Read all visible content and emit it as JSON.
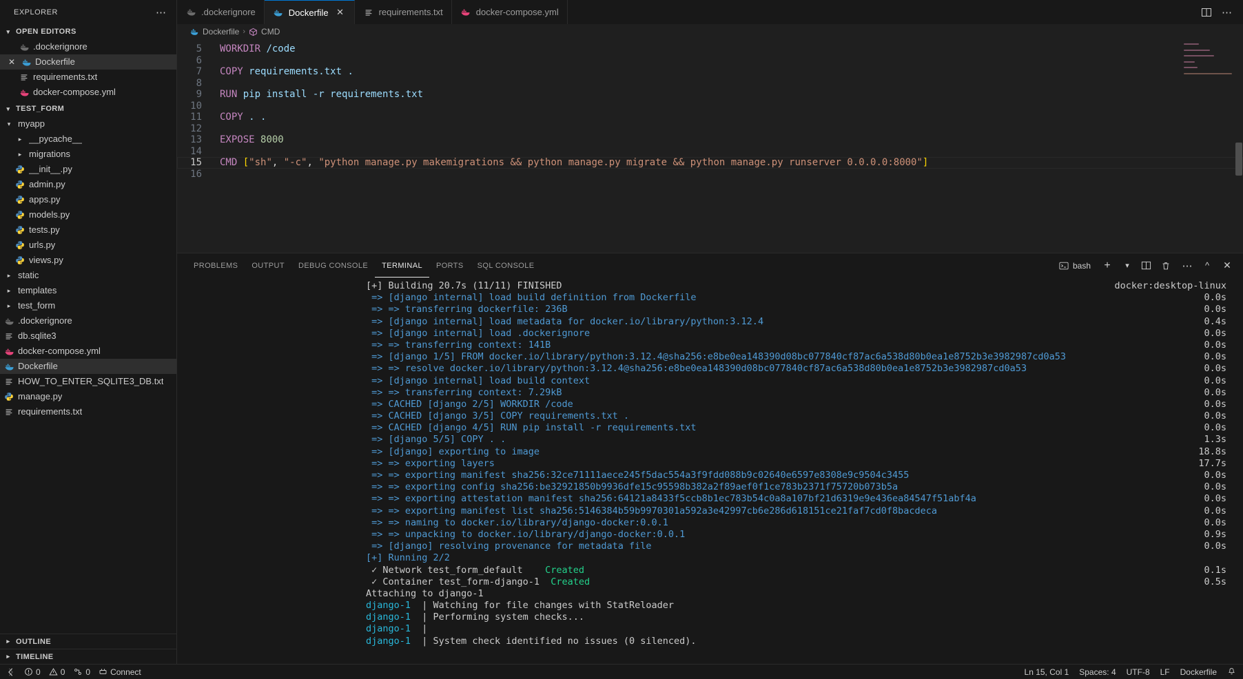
{
  "sidebar": {
    "title": "EXPLORER",
    "more_icon": "ellipsis-icon",
    "open_editors": {
      "label": "OPEN EDITORS",
      "items": [
        {
          "label": ".dockerignore",
          "icon": "docker-icon-dim",
          "active": false,
          "closable": false,
          "indent": 38
        },
        {
          "label": "Dockerfile",
          "icon": "docker-icon",
          "active": true,
          "closable": true,
          "indent": 20
        },
        {
          "label": "requirements.txt",
          "icon": "text-icon",
          "active": false,
          "closable": false,
          "indent": 38
        },
        {
          "label": "docker-compose.yml",
          "icon": "compose-icon",
          "active": false,
          "closable": false,
          "indent": 38
        }
      ]
    },
    "project": {
      "label": "TEST_FORM",
      "items": [
        {
          "label": "myapp",
          "type": "folder-open",
          "indent": 16
        },
        {
          "label": "__pycache__",
          "type": "folder",
          "indent": 32
        },
        {
          "label": "migrations",
          "type": "folder",
          "indent": 32
        },
        {
          "label": "__init__.py",
          "type": "python",
          "indent": 32
        },
        {
          "label": "admin.py",
          "type": "python",
          "indent": 32
        },
        {
          "label": "apps.py",
          "type": "python",
          "indent": 32
        },
        {
          "label": "models.py",
          "type": "python",
          "indent": 32
        },
        {
          "label": "tests.py",
          "type": "python",
          "indent": 32
        },
        {
          "label": "urls.py",
          "type": "python",
          "indent": 32
        },
        {
          "label": "views.py",
          "type": "python",
          "indent": 32
        },
        {
          "label": "static",
          "type": "folder",
          "indent": 16
        },
        {
          "label": "templates",
          "type": "folder",
          "indent": 16
        },
        {
          "label": "test_form",
          "type": "folder",
          "indent": 16
        },
        {
          "label": ".dockerignore",
          "type": "docker-dim",
          "indent": 16
        },
        {
          "label": "db.sqlite3",
          "type": "text",
          "indent": 16
        },
        {
          "label": "docker-compose.yml",
          "type": "compose",
          "indent": 16
        },
        {
          "label": "Dockerfile",
          "type": "docker",
          "indent": 16,
          "active": true
        },
        {
          "label": "HOW_TO_ENTER_SQLITE3_DB.txt",
          "type": "text",
          "indent": 16
        },
        {
          "label": "manage.py",
          "type": "python",
          "indent": 16
        },
        {
          "label": "requirements.txt",
          "type": "text",
          "indent": 16
        }
      ]
    },
    "footer": [
      {
        "label": "OUTLINE"
      },
      {
        "label": "TIMELINE"
      }
    ]
  },
  "tabs": {
    "items": [
      {
        "label": ".dockerignore",
        "icon": "docker-icon-dim",
        "active": false,
        "closable": false
      },
      {
        "label": "Dockerfile",
        "icon": "docker-icon",
        "active": true,
        "closable": true
      },
      {
        "label": "requirements.txt",
        "icon": "text-icon",
        "active": false,
        "closable": false
      },
      {
        "label": "docker-compose.yml",
        "icon": "compose-icon",
        "active": false,
        "closable": false
      }
    ],
    "actions": [
      {
        "name": "split-editor-icon"
      },
      {
        "name": "more-actions-icon"
      }
    ]
  },
  "breadcrumb": {
    "file": "Dockerfile",
    "separator": "›",
    "symbol": "CMD",
    "symbol_icon": "cube-icon"
  },
  "editor": {
    "lines": [
      {
        "n": "5",
        "tokens": [
          {
            "t": "WORKDIR",
            "c": "kw"
          },
          {
            "t": " ",
            "c": "plain"
          },
          {
            "t": "/code",
            "c": "path"
          }
        ]
      },
      {
        "n": "6",
        "tokens": []
      },
      {
        "n": "7",
        "tokens": [
          {
            "t": "COPY",
            "c": "kw"
          },
          {
            "t": " ",
            "c": "plain"
          },
          {
            "t": "requirements.txt .",
            "c": "path"
          }
        ]
      },
      {
        "n": "8",
        "tokens": []
      },
      {
        "n": "9",
        "tokens": [
          {
            "t": "RUN",
            "c": "kw"
          },
          {
            "t": " pip install -r requirements.txt",
            "c": "path"
          }
        ]
      },
      {
        "n": "10",
        "tokens": []
      },
      {
        "n": "11",
        "tokens": [
          {
            "t": "COPY",
            "c": "kw"
          },
          {
            "t": " ",
            "c": "plain"
          },
          {
            "t": ". .",
            "c": "path"
          }
        ]
      },
      {
        "n": "12",
        "tokens": []
      },
      {
        "n": "13",
        "tokens": [
          {
            "t": "EXPOSE",
            "c": "kw"
          },
          {
            "t": " ",
            "c": "plain"
          },
          {
            "t": "8000",
            "c": "num"
          }
        ]
      },
      {
        "n": "14",
        "tokens": []
      },
      {
        "n": "15",
        "current": true,
        "tokens": [
          {
            "t": "CMD",
            "c": "kw"
          },
          {
            "t": " ",
            "c": "plain"
          },
          {
            "t": "[",
            "c": "brk"
          },
          {
            "t": "\"sh\"",
            "c": "str"
          },
          {
            "t": ", ",
            "c": "plain"
          },
          {
            "t": "\"-c\"",
            "c": "str"
          },
          {
            "t": ", ",
            "c": "plain"
          },
          {
            "t": "\"python manage.py makemigrations && python manage.py migrate && python manage.py runserver 0.0.0.0:8000\"",
            "c": "str"
          },
          {
            "t": "]",
            "c": "brk"
          }
        ]
      },
      {
        "n": "16",
        "tokens": []
      }
    ]
  },
  "panel": {
    "tabs": [
      {
        "label": "PROBLEMS",
        "active": false
      },
      {
        "label": "OUTPUT",
        "active": false
      },
      {
        "label": "DEBUG CONSOLE",
        "active": false
      },
      {
        "label": "TERMINAL",
        "active": true
      },
      {
        "label": "PORTS",
        "active": false
      },
      {
        "label": "SQL CONSOLE",
        "active": false
      }
    ],
    "shell": {
      "label": "bash",
      "icon": "terminal-bash-icon"
    },
    "actions": [
      {
        "name": "new-terminal-icon",
        "glyph": "+"
      },
      {
        "name": "chevron-down-icon",
        "glyph": "⌄"
      },
      {
        "name": "split-terminal-icon",
        "glyph": "◫"
      },
      {
        "name": "kill-terminal-icon",
        "glyph": "🗑"
      },
      {
        "name": "more-actions-icon",
        "glyph": "⋯"
      },
      {
        "name": "maximize-panel-icon",
        "glyph": "⌃"
      },
      {
        "name": "close-panel-icon",
        "glyph": "✕"
      }
    ],
    "context_label": "docker:desktop-linux"
  },
  "terminal": {
    "lines": [
      {
        "msg": "[+] Building 20.7s (11/11) FINISHED",
        "color": "c-white",
        "dur": ""
      },
      {
        "msg": " => [django internal] load build definition from Dockerfile",
        "color": "c-blue",
        "dur": "0.0s"
      },
      {
        "msg": " => => transferring dockerfile: 236B",
        "color": "c-blue",
        "dur": "0.0s"
      },
      {
        "msg": " => [django internal] load metadata for docker.io/library/python:3.12.4",
        "color": "c-blue",
        "dur": "0.4s"
      },
      {
        "msg": " => [django internal] load .dockerignore",
        "color": "c-blue",
        "dur": "0.0s"
      },
      {
        "msg": " => => transferring context: 141B",
        "color": "c-blue",
        "dur": "0.0s"
      },
      {
        "msg": " => [django 1/5] FROM docker.io/library/python:3.12.4@sha256:e8be0ea148390d08bc077840cf87ac6a538d80b0ea1e8752b3e3982987cd0a53",
        "color": "c-blue",
        "dur": "0.0s"
      },
      {
        "msg": " => => resolve docker.io/library/python:3.12.4@sha256:e8be0ea148390d08bc077840cf87ac6a538d80b0ea1e8752b3e3982987cd0a53",
        "color": "c-blue",
        "dur": "0.0s"
      },
      {
        "msg": " => [django internal] load build context",
        "color": "c-blue",
        "dur": "0.0s"
      },
      {
        "msg": " => => transferring context: 7.29kB",
        "color": "c-blue",
        "dur": "0.0s"
      },
      {
        "msg": " => CACHED [django 2/5] WORKDIR /code",
        "color": "c-blue",
        "dur": "0.0s"
      },
      {
        "msg": " => CACHED [django 3/5] COPY requirements.txt .",
        "color": "c-blue",
        "dur": "0.0s"
      },
      {
        "msg": " => CACHED [django 4/5] RUN pip install -r requirements.txt",
        "color": "c-blue",
        "dur": "0.0s"
      },
      {
        "msg": " => [django 5/5] COPY . .",
        "color": "c-blue",
        "dur": "1.3s"
      },
      {
        "msg": " => [django] exporting to image",
        "color": "c-blue",
        "dur": "18.8s"
      },
      {
        "msg": " => => exporting layers",
        "color": "c-blue",
        "dur": "17.7s"
      },
      {
        "msg": " => => exporting manifest sha256:32ce71111aece245f5dac554a3f9fdd088b9c02640e6597e8308e9c9504c3455",
        "color": "c-blue",
        "dur": "0.0s"
      },
      {
        "msg": " => => exporting config sha256:be32921850b9936dfe15c95598b382a2f89aef0f1ce783b2371f75720b073b5a",
        "color": "c-blue",
        "dur": "0.0s"
      },
      {
        "msg": " => => exporting attestation manifest sha256:64121a8433f5ccb8b1ec783b54c0a8a107bf21d6319e9e436ea84547f51abf4a",
        "color": "c-blue",
        "dur": "0.0s"
      },
      {
        "msg": " => => exporting manifest list sha256:5146384b59b9970301a592a3e42997cb6e286d618151ce21faf7cd0f8bacdeca",
        "color": "c-blue",
        "dur": "0.0s"
      },
      {
        "msg": " => => naming to docker.io/library/django-docker:0.0.1",
        "color": "c-blue",
        "dur": "0.0s"
      },
      {
        "msg": " => => unpacking to docker.io/library/django-docker:0.0.1",
        "color": "c-blue",
        "dur": "0.9s"
      },
      {
        "msg": " => [django] resolving provenance for metadata file",
        "color": "c-blue",
        "dur": "0.0s"
      },
      {
        "msg": "[+] Running 2/2",
        "color": "c-blue",
        "dur": ""
      },
      {
        "segments": [
          {
            "t": " ✓ Network test_form_default    ",
            "c": "c-white"
          },
          {
            "t": "Created",
            "c": "c-green"
          }
        ],
        "dur": "0.1s"
      },
      {
        "segments": [
          {
            "t": " ✓ Container test_form-django-1  ",
            "c": "c-white"
          },
          {
            "t": "Created",
            "c": "c-green"
          }
        ],
        "dur": "0.5s"
      },
      {
        "msg": "Attaching to django-1",
        "color": "c-white",
        "dur": ""
      },
      {
        "segments": [
          {
            "t": "django-1",
            "c": "c-cyan"
          },
          {
            "t": "  | Watching for file changes with StatReloader",
            "c": "c-white"
          }
        ],
        "dur": ""
      },
      {
        "segments": [
          {
            "t": "django-1",
            "c": "c-cyan"
          },
          {
            "t": "  | Performing system checks...",
            "c": "c-white"
          }
        ],
        "dur": ""
      },
      {
        "segments": [
          {
            "t": "django-1",
            "c": "c-cyan"
          },
          {
            "t": "  | ",
            "c": "c-white"
          }
        ],
        "dur": ""
      },
      {
        "segments": [
          {
            "t": "django-1",
            "c": "c-cyan"
          },
          {
            "t": "  | System check identified no issues (0 silenced).",
            "c": "c-white"
          }
        ],
        "dur": ""
      }
    ]
  },
  "status": {
    "left": [
      {
        "name": "remote-icon",
        "label": ""
      },
      {
        "name": "problems-errors",
        "label": "0",
        "icon": "error-icon"
      },
      {
        "name": "problems-warnings",
        "label": "0",
        "icon": "warning-icon"
      },
      {
        "name": "ports-forwarded",
        "label": "0",
        "icon": "ports-icon"
      },
      {
        "name": "connect-button",
        "label": "Connect",
        "icon": "plug-icon"
      }
    ],
    "right": [
      {
        "name": "cursor-position",
        "label": "Ln 15, Col 1"
      },
      {
        "name": "indentation",
        "label": "Spaces: 4"
      },
      {
        "name": "encoding",
        "label": "UTF-8"
      },
      {
        "name": "eol",
        "label": "LF"
      },
      {
        "name": "language-mode",
        "label": "Dockerfile"
      },
      {
        "name": "notifications",
        "label": "",
        "icon": "bell-icon"
      }
    ]
  },
  "colors": {
    "accent": "#0078d4",
    "terminal_blue": "#4f9ad4",
    "terminal_green": "#23d18b",
    "terminal_cyan": "#29b8db",
    "keyword": "#c586c0",
    "string": "#ce9178",
    "number": "#b5cea8",
    "bg": "#1f1f1f",
    "sidebar_bg": "#181818"
  }
}
